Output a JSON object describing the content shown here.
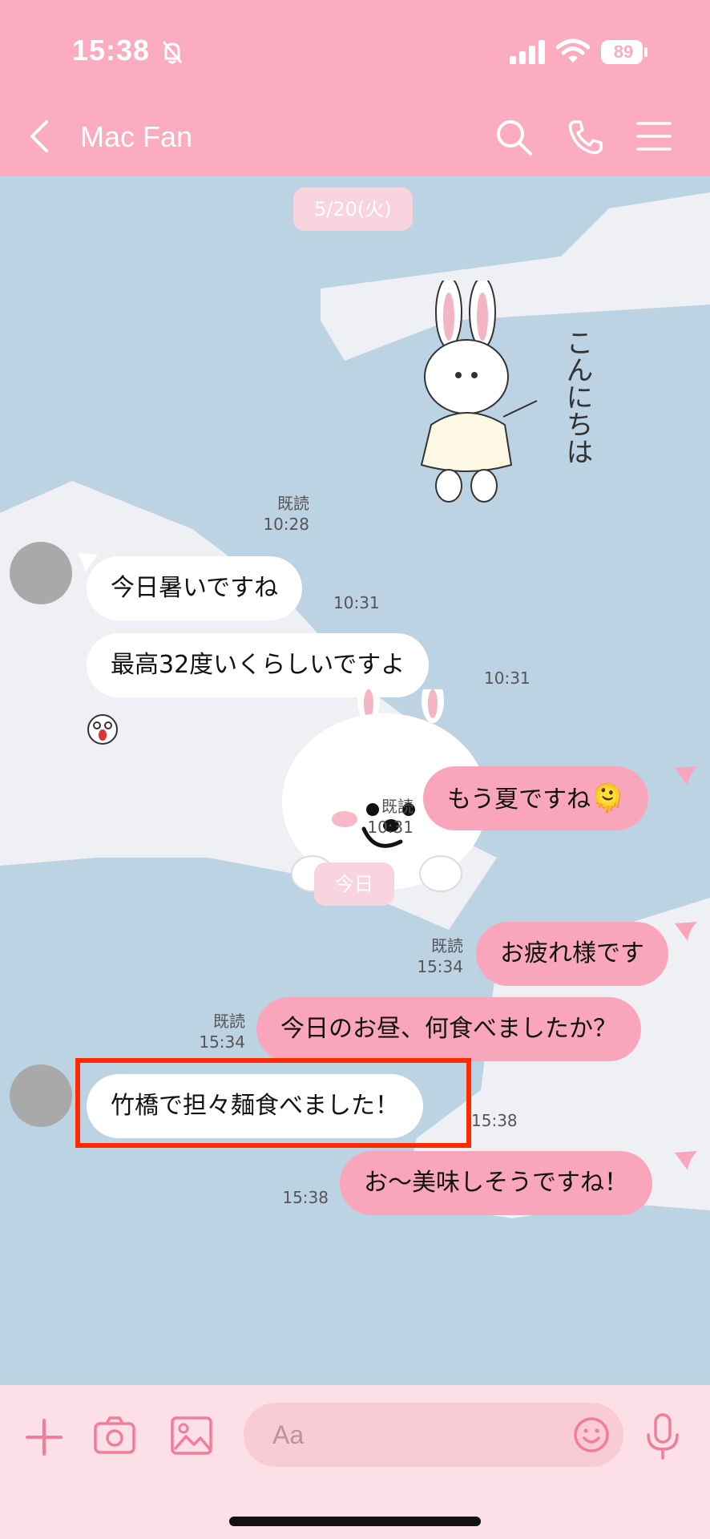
{
  "status_bar": {
    "time": "15:38",
    "battery": "89",
    "icons": [
      "bell-slash-icon",
      "signal-icon",
      "wifi-icon",
      "battery-icon"
    ]
  },
  "header": {
    "title": "Mac Fan",
    "icons": [
      "back-chevron-icon",
      "search-icon",
      "phone-icon",
      "menu-icon"
    ]
  },
  "colors": {
    "header_bg": "#fbacc0",
    "chat_bg": "#bcd3e3",
    "outgoing_bubble": "#f9a6bd",
    "incoming_bubble": "#ffffff",
    "highlight_border": "#ff2a00",
    "input_bar_bg": "#fde0e7"
  },
  "chat": {
    "date_separator_1": "5/20(火)",
    "date_separator_2": "今日",
    "sticker_1": {
      "text": "こんにちは",
      "read": "既読",
      "time": "10:28"
    },
    "msg_1": {
      "text": "今日暑いですね",
      "time": "10:31"
    },
    "msg_2": {
      "text": "最高32度いくらしいですよ",
      "time": "10:31"
    },
    "msg_3": {
      "text": "もう夏ですね",
      "emoji": "🫠",
      "read": "既読",
      "time": "10:31"
    },
    "msg_4": {
      "text": "お疲れ様です",
      "read": "既読",
      "time": "15:34"
    },
    "msg_5": {
      "text": "今日のお昼、何食べましたか？",
      "read": "既読",
      "time": "15:34"
    },
    "msg_6": {
      "text": "竹橋で担々麺食べました！",
      "time": "15:38"
    },
    "msg_7": {
      "text": "お〜美味しそうですね！",
      "time": "15:38"
    }
  },
  "input_bar": {
    "placeholder": "Aa",
    "icons": [
      "plus-icon",
      "camera-icon",
      "image-icon",
      "emoji-icon",
      "microphone-icon"
    ]
  }
}
